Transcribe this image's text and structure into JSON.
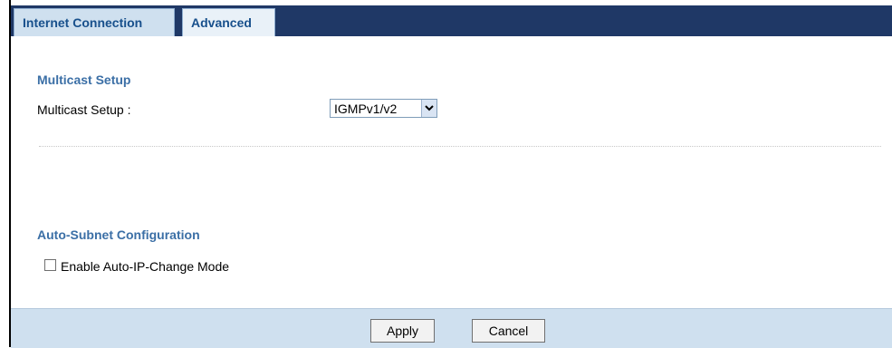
{
  "tabs": [
    {
      "label": "Internet Connection"
    },
    {
      "label": "Advanced"
    }
  ],
  "multicast": {
    "section_title": "Multicast Setup",
    "field_label": "Multicast Setup :",
    "selected_value": "IGMPv1/v2"
  },
  "auto_subnet": {
    "section_title": "Auto-Subnet Configuration",
    "checkbox_label": "Enable Auto-IP-Change Mode",
    "checked": false
  },
  "footer": {
    "apply_label": "Apply",
    "cancel_label": "Cancel"
  },
  "colors": {
    "header_bar": "#1f3866",
    "tab_text": "#18508c",
    "section_title": "#3b6fa6",
    "footer_bg": "#cfe0ef"
  }
}
